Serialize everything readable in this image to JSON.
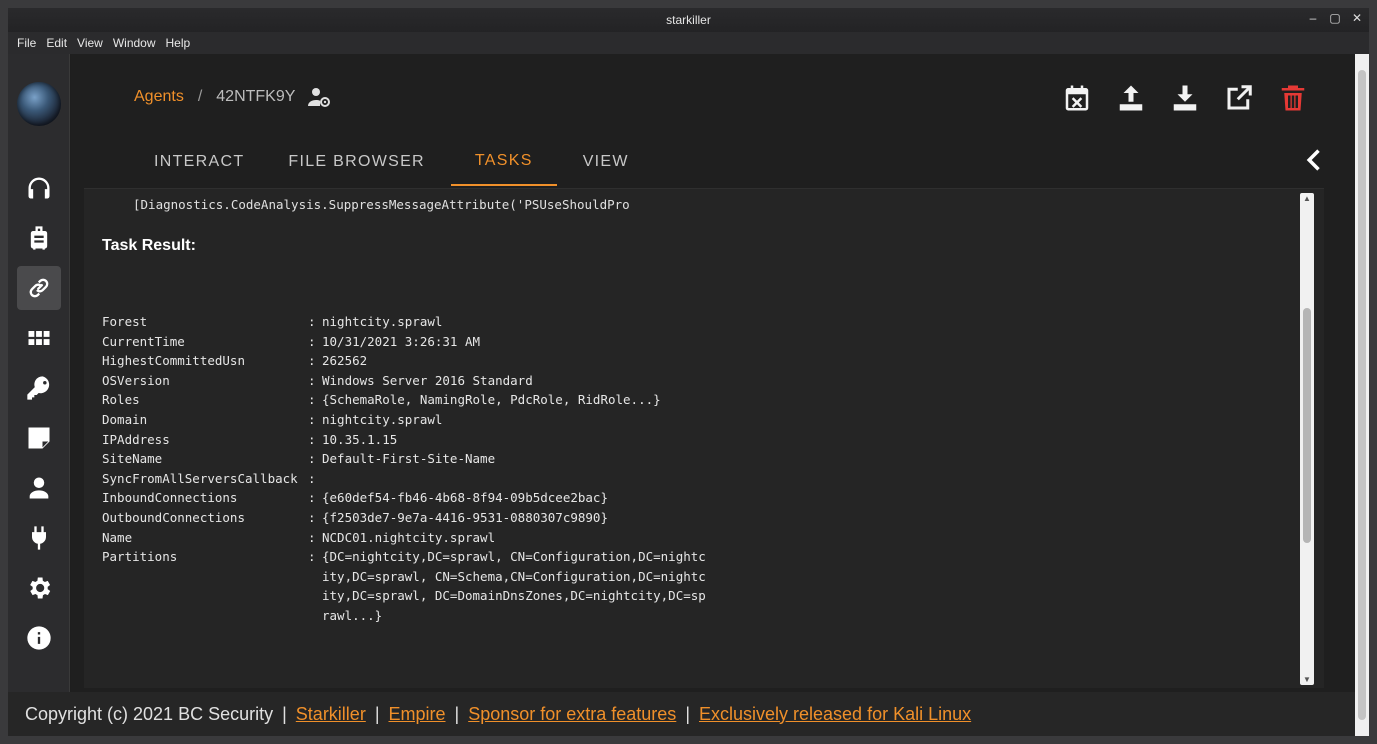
{
  "window": {
    "title": "starkiller",
    "controls": [
      "–",
      "▢",
      "✕"
    ]
  },
  "menu": [
    "File",
    "Edit",
    "View",
    "Window",
    "Help"
  ],
  "sidebar": {
    "items": [
      {
        "name": "listeners",
        "icon": "headphones-icon"
      },
      {
        "name": "stagers",
        "icon": "luggage-icon"
      },
      {
        "name": "agents",
        "icon": "link-icon",
        "active": true
      },
      {
        "name": "modules",
        "icon": "grid-icon"
      },
      {
        "name": "credentials",
        "icon": "key-icon"
      },
      {
        "name": "reporting",
        "icon": "note-icon"
      },
      {
        "name": "users",
        "icon": "user-icon"
      },
      {
        "name": "plugins",
        "icon": "plug-icon"
      },
      {
        "name": "settings",
        "icon": "gear-icon"
      },
      {
        "name": "about",
        "icon": "info-icon"
      }
    ]
  },
  "header": {
    "breadcrumb_root": "Agents",
    "breadcrumb_sep": "/",
    "agent_id": "42NTFK9Y",
    "tabs": [
      "INTERACT",
      "FILE BROWSER",
      "TASKS",
      "VIEW"
    ],
    "active_tab": "TASKS"
  },
  "toolbar": [
    "calendar-x-icon",
    "upload-icon",
    "download-icon",
    "open-external-icon",
    "delete-icon"
  ],
  "colors": {
    "accent": "#f0902a",
    "delete": "#e53935"
  },
  "task": {
    "command_line": "[Diagnostics.CodeAnalysis.SuppressMessageAttribute('PSUseShouldPro",
    "result_title": "Task Result:",
    "rows": [
      {
        "key": "Forest",
        "value": "nightcity.sprawl"
      },
      {
        "key": "CurrentTime",
        "value": "10/31/2021 3:26:31 AM"
      },
      {
        "key": "HighestCommittedUsn",
        "value": "262562"
      },
      {
        "key": "OSVersion",
        "value": "Windows Server 2016 Standard"
      },
      {
        "key": "Roles",
        "value": "{SchemaRole, NamingRole, PdcRole, RidRole...}"
      },
      {
        "key": "Domain",
        "value": "nightcity.sprawl"
      },
      {
        "key": "IPAddress",
        "value": "10.35.1.15"
      },
      {
        "key": "SiteName",
        "value": "Default-First-Site-Name"
      },
      {
        "key": "SyncFromAllServersCallback",
        "value": ""
      },
      {
        "key": "InboundConnections",
        "value": "{e60def54-fb46-4b68-8f94-09b5dcee2bac}"
      },
      {
        "key": "OutboundConnections",
        "value": "{f2503de7-9e7a-4416-9531-0880307c9890}"
      },
      {
        "key": "Name",
        "value": "NCDC01.nightcity.sprawl"
      },
      {
        "key": "Partitions",
        "value": "{DC=nightcity,DC=sprawl, CN=Configuration,DC=nightc"
      }
    ],
    "partitions_cont": [
      "ity,DC=sprawl, CN=Schema,CN=Configuration,DC=nightc",
      "ity,DC=sprawl, DC=DomainDnsZones,DC=nightcity,DC=sp",
      "rawl...}"
    ]
  },
  "footer": {
    "copyright": "Copyright (c) 2021 BC Security",
    "sep": "|",
    "links": [
      "Starkiller",
      "Empire",
      "Sponsor for extra features",
      "Exclusively released for Kali Linux"
    ]
  }
}
